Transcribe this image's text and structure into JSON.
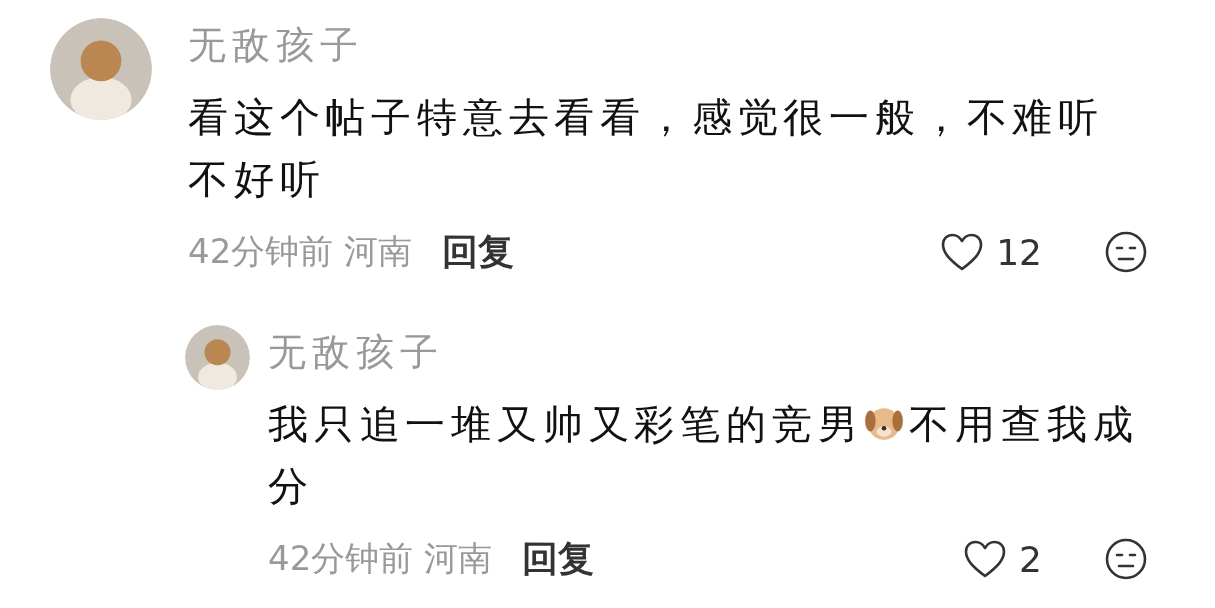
{
  "comments": [
    {
      "author": "无敌孩子",
      "parts": [
        {
          "kind": "text",
          "text": "看这个帖子特意去看看，感觉很一般，不难听不好听"
        }
      ],
      "time": "42分钟前",
      "location": "河南",
      "reply_label": "回复",
      "likes": "12",
      "liked": false,
      "replies": [
        {
          "author": "无敌孩子",
          "parts": [
            {
              "kind": "text",
              "text": "我只追一堆又帅又彩笔的竞男"
            },
            {
              "kind": "emoji"
            },
            {
              "kind": "text",
              "text": "不用查我成分"
            }
          ],
          "time": "42分钟前",
          "location": "河南",
          "reply_label": "回复",
          "likes": "2",
          "liked": false
        }
      ]
    }
  ]
}
